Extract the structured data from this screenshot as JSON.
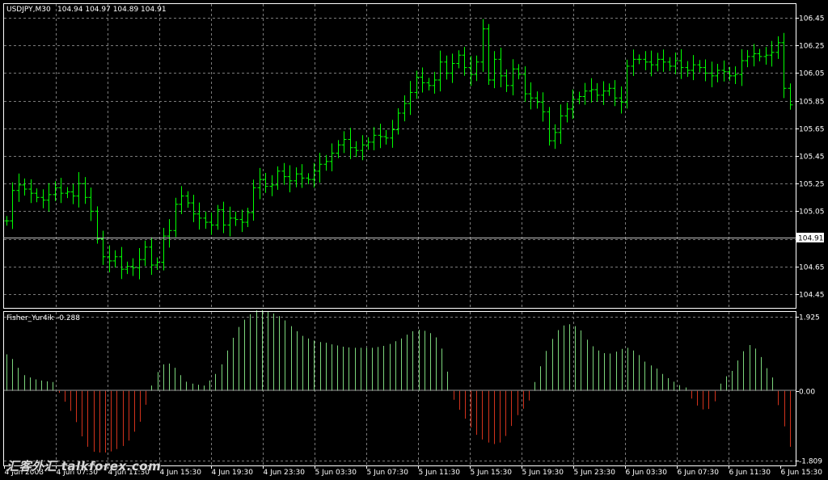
{
  "window": {
    "symbol_title": "USDJPY,M30",
    "ohlc_text": "104.94 104.97 104.89 104.91",
    "current_price_label": "104.91"
  },
  "indicator": {
    "title": "Fisher_Yur4ik",
    "value_text": "-0.288",
    "axis_labels": [
      "1.925",
      "0.00",
      "-1.809"
    ]
  },
  "watermark": "汇客外汇 talkforex.com",
  "colors": {
    "background": "#000000",
    "bars": "#00ff00",
    "positive": "#7cd67c",
    "negative": "#d2321c",
    "grid": "#7a7a7a"
  },
  "chart_data": [
    {
      "type": "bar",
      "name": "USDJPY,M30",
      "ylim": [
        104.35,
        106.55
      ],
      "y_ticks": [
        "106.45",
        "106.25",
        "106.05",
        "105.85",
        "105.65",
        "105.45",
        "105.25",
        "105.05",
        "104.85",
        "104.65",
        "104.45"
      ],
      "x_tick_labels": [
        "4 Jun 2008",
        "4 Jun 07:30",
        "4 Jun 11:30",
        "4 Jun 15:30",
        "4 Jun 19:30",
        "4 Jun 23:30",
        "5 Jun 03:30",
        "5 Jun 07:30",
        "5 Jun 11:30",
        "5 Jun 15:30",
        "5 Jun 19:30",
        "5 Jun 23:30",
        "6 Jun 03:30",
        "6 Jun 07:30",
        "6 Jun 11:30",
        "6 Jun 15:30"
      ],
      "current_price": 104.91,
      "close": [
        104.98,
        105.2,
        105.24,
        105.21,
        105.18,
        105.15,
        105.13,
        105.17,
        105.22,
        105.18,
        105.19,
        105.16,
        105.25,
        105.15,
        105.05,
        104.85,
        104.72,
        104.69,
        104.72,
        104.63,
        104.65,
        104.64,
        104.7,
        104.79,
        104.66,
        104.68,
        104.87,
        104.91,
        105.1,
        105.16,
        105.11,
        105.03,
        105.0,
        104.97,
        104.95,
        105.06,
        104.95,
        105.0,
        104.99,
        104.97,
        105.04,
        105.22,
        105.28,
        105.23,
        105.24,
        105.34,
        105.3,
        105.27,
        105.32,
        105.29,
        105.28,
        105.34,
        105.39,
        105.41,
        105.47,
        105.53,
        105.57,
        105.51,
        105.49,
        105.53,
        105.55,
        105.6,
        105.59,
        105.58,
        105.64,
        105.76,
        105.83,
        105.91,
        106.02,
        105.98,
        105.96,
        106.0,
        106.13,
        106.05,
        106.12,
        106.18,
        106.09,
        106.04,
        106.13,
        106.37,
        106.0,
        106.15,
        106.03,
        105.96,
        106.08,
        106.04,
        105.9,
        105.87,
        105.84,
        105.77,
        105.56,
        105.62,
        105.74,
        105.79,
        105.86,
        105.88,
        105.92,
        105.93,
        105.89,
        105.92,
        105.94,
        105.87,
        105.84,
        106.1,
        106.15,
        106.15,
        106.13,
        106.11,
        106.15,
        106.13,
        106.1,
        106.14,
        106.09,
        106.07,
        106.11,
        106.09,
        106.05,
        106.03,
        106.07,
        106.06,
        106.03,
        106.04,
        106.14,
        106.17,
        106.19,
        106.17,
        106.18,
        106.2,
        106.27,
        105.94,
        105.82
      ]
    },
    {
      "type": "bar",
      "name": "Fisher_Yur4ik",
      "ylim": [
        -1.809,
        1.925
      ],
      "y_ticks": [
        "1.925",
        "0.00",
        "-1.809"
      ],
      "values": [
        0.95,
        0.83,
        0.6,
        0.41,
        0.35,
        0.3,
        0.27,
        0.25,
        0.23,
        -0.05,
        -0.28,
        -0.52,
        -0.81,
        -1.18,
        -1.45,
        -1.58,
        -1.6,
        -1.6,
        -1.57,
        -1.51,
        -1.43,
        -1.29,
        -1.06,
        -0.8,
        -0.36,
        0.14,
        0.49,
        0.69,
        0.71,
        0.6,
        0.41,
        0.24,
        0.19,
        0.16,
        0.14,
        0.27,
        0.44,
        0.69,
        1.05,
        1.38,
        1.66,
        1.85,
        1.99,
        2.09,
        2.1,
        2.07,
        2.01,
        1.94,
        1.83,
        1.68,
        1.55,
        1.43,
        1.36,
        1.31,
        1.27,
        1.25,
        1.21,
        1.18,
        1.15,
        1.13,
        1.12,
        1.12,
        1.12,
        1.12,
        1.14,
        1.17,
        1.22,
        1.29,
        1.36,
        1.46,
        1.55,
        1.59,
        1.56,
        1.5,
        1.39,
        1.1,
        0.5,
        -0.23,
        -0.49,
        -0.72,
        -0.95,
        -1.14,
        -1.26,
        -1.34,
        -1.38,
        -1.34,
        -1.17,
        -0.91,
        -0.63,
        -0.46,
        -0.25,
        0.23,
        0.64,
        1.04,
        1.35,
        1.58,
        1.7,
        1.73,
        1.68,
        1.57,
        1.33,
        1.16,
        1.05,
        0.98,
        0.97,
        1.02,
        1.09,
        1.12,
        1.05,
        0.93,
        0.76,
        0.66,
        0.58,
        0.44,
        0.33,
        0.24,
        0.15,
        0.09,
        -0.2,
        -0.38,
        -0.48,
        -0.47,
        -0.27,
        0.19,
        0.38,
        0.52,
        0.79,
        1.03,
        1.19,
        1.1,
        0.88,
        0.59,
        0.35,
        -0.37,
        -0.92,
        -1.45
      ]
    }
  ]
}
